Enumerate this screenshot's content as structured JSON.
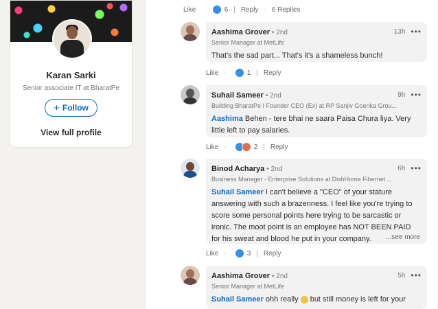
{
  "profile": {
    "name": "Karan Sarki",
    "title": "Senior associate IT at BharatPe",
    "follow_label": "Follow",
    "view_profile_label": "View full profile"
  },
  "post_actions": {
    "like_label": "Like",
    "reaction_count": "6",
    "reply_label": "Reply",
    "replies_label": "6 Replies"
  },
  "comments": [
    {
      "author": "Aashima Grover",
      "degree": "• 2nd",
      "headline": "Senior Manager at MetLife",
      "time": "13h",
      "text": "That's the sad part... That's it's a shameless bunch!",
      "like_label": "Like",
      "reaction_count": "1",
      "reply_label": "Reply"
    },
    {
      "author": "Suhail Sameer",
      "degree": "• 2nd",
      "headline": "Building BharatPe I Founder CEO (Ex) at RP Sanjiv Goenka Grou...",
      "time": "9h",
      "mention": "Aashima",
      "text": " Behen - tere bhai ne saara Paisa Chura liya. Very little left to pay salaries.",
      "like_label": "Like",
      "reaction_count": "2",
      "reply_label": "Reply"
    },
    {
      "author": "Binod Acharya",
      "degree": "• 2nd",
      "headline": "Business Manager - Enterprise Solutions at DishHome Fibernet ...",
      "time": "6h",
      "mention": "Suhail Sameer",
      "text": " I can't believe a \"CEO\" of your stature answering with such a brazenness. I feel like you're trying to score some personal points here trying to be sarcastic or ironic. The moot point is an employee has NOT BEEN PAID for his sweat and blood he put in your company.",
      "see_more": "...see more",
      "like_label": "Like",
      "reaction_count": "3",
      "reply_label": "Reply"
    },
    {
      "author": "Aashima Grover",
      "degree": "• 2nd",
      "headline": "Senior Manager at MetLife",
      "time": "5h",
      "mention": "Suhail Sameer",
      "text_a": " ohh really ",
      "text_b": " but still money is left for your"
    }
  ],
  "colors": {
    "link": "#0a66c2",
    "like": "#378fe9",
    "bubble": "#f2f2f2"
  },
  "icons": [
    "plus-icon",
    "like-reaction-icon",
    "love-reaction-icon",
    "more-options-icon",
    "emoji-icon"
  ]
}
